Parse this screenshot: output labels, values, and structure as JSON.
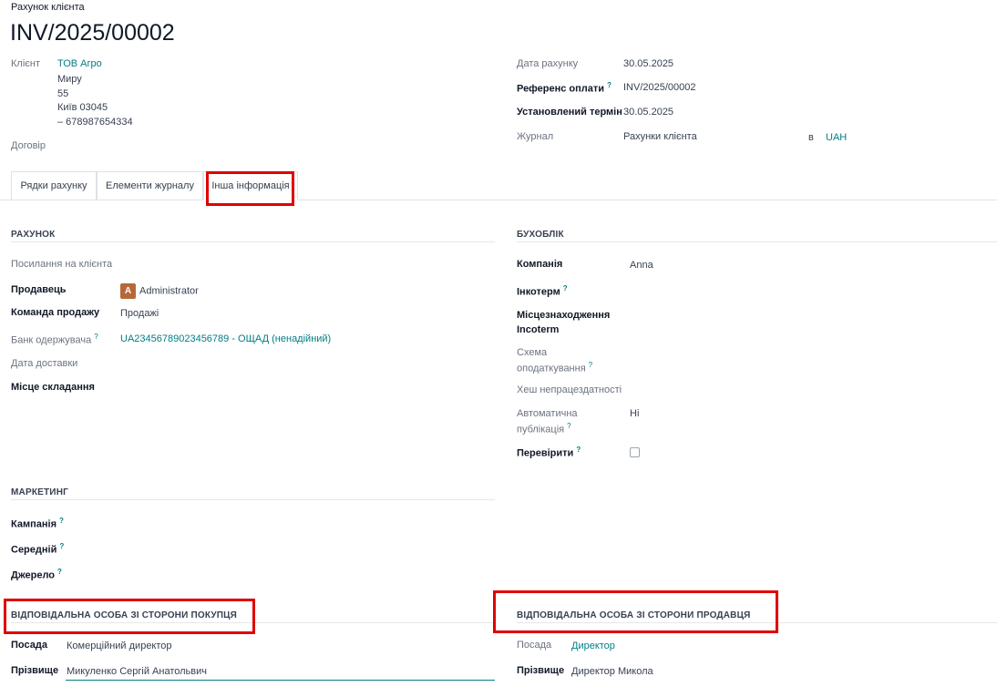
{
  "header": {
    "subtitle": "Рахунок клієнта",
    "title": "INV/2025/00002"
  },
  "client": {
    "label": "Клієнт",
    "name": "ТОВ Агро",
    "address_lines": [
      "Миру",
      "55",
      "Київ 03045",
      "– 678987654334"
    ]
  },
  "contract_label": "Договір",
  "invoice_info": {
    "date_label": "Дата рахунку",
    "date_value": "30.05.2025",
    "payment_ref_label": "Референс оплати",
    "payment_ref_value": "INV/2025/00002",
    "due_label": "Установлений термін",
    "due_value": "30.05.2025",
    "journal_label": "Журнал",
    "journal_value": "Рахунки клієнта",
    "currency_prefix": "в",
    "currency_value": "UAH",
    "help_mark": "?"
  },
  "tabs": [
    "Рядки рахунку",
    "Елементи журналу",
    "Інша інформація"
  ],
  "invoice_section": {
    "header": "РАХУНОК",
    "customer_ref_label": "Посилання на клієнта",
    "salesperson_label": "Продавець",
    "salesperson_initial": "A",
    "salesperson_value": "Administrator",
    "sales_team_label": "Команда продажу",
    "sales_team_value": "Продажі",
    "bank_label": "Банк одержувача",
    "bank_value": "UA23456789023456789 - ОЩАД (ненадійний)",
    "delivery_date_label": "Дата доставки",
    "place_label": "Місце складання"
  },
  "accounting_section": {
    "header": "БУХОБЛІК",
    "company_label": "Компанія",
    "company_value": "Anna",
    "incoterm_label": "Інкотерм",
    "incoterm_location_label_1": "Місцезнаходження",
    "incoterm_location_label_2": "Incoterm",
    "tax_scheme_label_1": "Схема",
    "tax_scheme_label_2": "оподаткування",
    "disability_hash_label": "Хеш непрацездатності",
    "auto_publish_label_1": "Автоматична",
    "auto_publish_label_2": "публікація",
    "auto_publish_value": "Ні",
    "check_label": "Перевірити",
    "check_value": false
  },
  "marketing_section": {
    "header": "МАРКЕТИНГ",
    "campaign_label": "Кампанія",
    "medium_label": "Середній",
    "source_label": "Джерело"
  },
  "buyer_contact": {
    "header": "ВІДПОВІДАЛЬНА ОСОБА ЗІ СТОРОНИ ПОКУПЦЯ",
    "position_label": "Посада",
    "position_value": "Комерційний директор",
    "surname_label": "Прізвище",
    "surname_value": "Микуленко Сергій Анатольвич"
  },
  "seller_contact": {
    "header": "ВІДПОВІДАЛЬНА ОСОБА ЗІ СТОРОНИ ПРОДАВЦЯ",
    "position_label": "Посада",
    "position_value": "Директор",
    "surname_label": "Прізвище",
    "surname_value": "Директор Микола"
  },
  "colors": {
    "link": "#017e84",
    "highlight": "#e00000",
    "avatar": "#b5693a"
  }
}
